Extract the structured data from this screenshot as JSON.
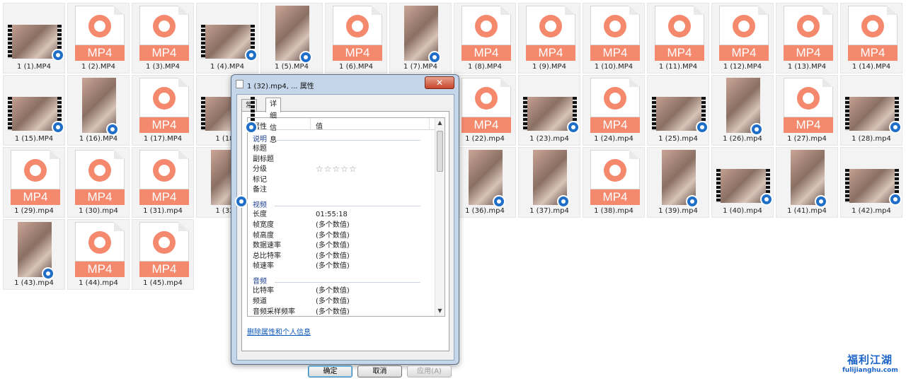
{
  "explorer": {
    "files": [
      {
        "name": "1 (1).MP4",
        "kind": "video-land"
      },
      {
        "name": "1 (2).MP4",
        "kind": "mp4"
      },
      {
        "name": "1 (3).MP4",
        "kind": "mp4"
      },
      {
        "name": "1 (4).MP4",
        "kind": "video-land"
      },
      {
        "name": "1 (5).MP4",
        "kind": "video-port"
      },
      {
        "name": "1 (6).MP4",
        "kind": "mp4"
      },
      {
        "name": "1 (7).MP4",
        "kind": "video-port"
      },
      {
        "name": "1 (8).MP4",
        "kind": "mp4"
      },
      {
        "name": "1 (9).MP4",
        "kind": "mp4"
      },
      {
        "name": "1 (10).MP4",
        "kind": "mp4"
      },
      {
        "name": "1 (11).MP4",
        "kind": "mp4"
      },
      {
        "name": "1 (12).MP4",
        "kind": "mp4"
      },
      {
        "name": "1 (13).MP4",
        "kind": "mp4"
      },
      {
        "name": "1 (14).MP4",
        "kind": "mp4"
      },
      {
        "name": "1 (15).MP4",
        "kind": "video-land"
      },
      {
        "name": "1 (16).MP4",
        "kind": "video-port"
      },
      {
        "name": "1 (17).MP4",
        "kind": "mp4"
      },
      {
        "name": "1 (18).",
        "kind": "video-land"
      },
      {
        "name": "",
        "kind": "hidden"
      },
      {
        "name": "",
        "kind": "hidden"
      },
      {
        "name": "",
        "kind": "hidden"
      },
      {
        "name": "1 (22).mp4",
        "kind": "mp4"
      },
      {
        "name": "1 (23).mp4",
        "kind": "video-land"
      },
      {
        "name": "1 (24).mp4",
        "kind": "mp4"
      },
      {
        "name": "1 (25).mp4",
        "kind": "video-land"
      },
      {
        "name": "1 (26).mp4",
        "kind": "video-port"
      },
      {
        "name": "1 (27).mp4",
        "kind": "mp4"
      },
      {
        "name": "1 (28).mp4",
        "kind": "video-land"
      },
      {
        "name": "1 (29).mp4",
        "kind": "mp4"
      },
      {
        "name": "1 (30).mp4",
        "kind": "mp4"
      },
      {
        "name": "1 (31).mp4",
        "kind": "mp4"
      },
      {
        "name": "1 (32).",
        "kind": "video-port"
      },
      {
        "name": "",
        "kind": "hidden"
      },
      {
        "name": "",
        "kind": "hidden"
      },
      {
        "name": "",
        "kind": "hidden"
      },
      {
        "name": "1 (36).mp4",
        "kind": "video-port"
      },
      {
        "name": "1 (37).mp4",
        "kind": "video-port"
      },
      {
        "name": "1 (38).mp4",
        "kind": "mp4"
      },
      {
        "name": "1 (39).mp4",
        "kind": "video-port"
      },
      {
        "name": "1 (40).mp4",
        "kind": "video-land"
      },
      {
        "name": "1 (41).mp4",
        "kind": "video-port"
      },
      {
        "name": "1 (42).mp4",
        "kind": "video-land"
      },
      {
        "name": "1 (43).mp4",
        "kind": "video-port"
      },
      {
        "name": "1 (44).mp4",
        "kind": "mp4"
      },
      {
        "name": "1 (45).mp4",
        "kind": "mp4"
      }
    ],
    "mp4_label": "MP4"
  },
  "dialog": {
    "title": "1 (32).mp4, ... 属性",
    "close_glyph": "✕",
    "tabs": [
      "常规",
      "详细信息"
    ],
    "active_tab": 1,
    "columns": {
      "property": "属性",
      "value": "值"
    },
    "rows": [
      {
        "type": "group",
        "key": "说明"
      },
      {
        "type": "item",
        "key": "标题",
        "value": ""
      },
      {
        "type": "item",
        "key": "副标题",
        "value": ""
      },
      {
        "type": "rating",
        "key": "分级",
        "value": "☆☆☆☆☆"
      },
      {
        "type": "item",
        "key": "标记",
        "value": ""
      },
      {
        "type": "item",
        "key": "备注",
        "value": ""
      },
      {
        "type": "group",
        "key": "视频"
      },
      {
        "type": "item",
        "key": "长度",
        "value": "01:55:18"
      },
      {
        "type": "item",
        "key": "帧宽度",
        "value": "(多个数值)"
      },
      {
        "type": "item",
        "key": "帧高度",
        "value": "(多个数值)"
      },
      {
        "type": "item",
        "key": "数据速率",
        "value": "(多个数值)"
      },
      {
        "type": "item",
        "key": "总比特率",
        "value": "(多个数值)"
      },
      {
        "type": "item",
        "key": "帧速率",
        "value": "(多个数值)"
      },
      {
        "type": "group",
        "key": "音频"
      },
      {
        "type": "item",
        "key": "比特率",
        "value": "(多个数值)"
      },
      {
        "type": "item",
        "key": "频道",
        "value": "(多个数值)"
      },
      {
        "type": "item",
        "key": "音频采样频率",
        "value": "(多个数值)"
      }
    ],
    "remove_link": "删除属性和个人信息",
    "buttons": {
      "ok": "确定",
      "cancel": "取消",
      "apply": "应用(A)"
    }
  },
  "watermark": {
    "main": "福利江湖",
    "sub": "fulijianghu.com"
  },
  "colors": {
    "mp4_accent": "#f4896d",
    "badge": "#1f6fc8",
    "link": "#0b56b6"
  }
}
